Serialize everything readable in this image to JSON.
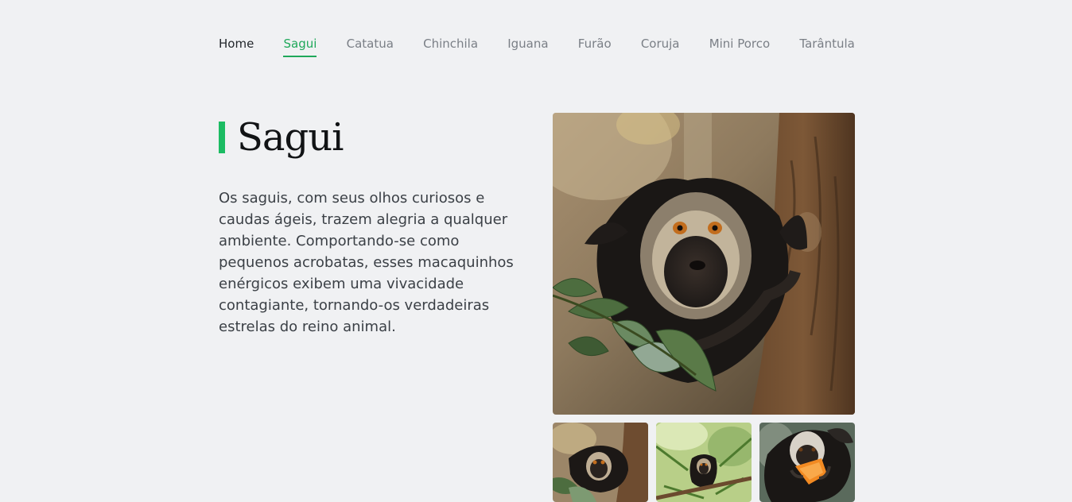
{
  "nav": {
    "items": [
      {
        "label": "Home"
      },
      {
        "label": "Sagui"
      },
      {
        "label": "Catatua"
      },
      {
        "label": "Chinchila"
      },
      {
        "label": "Iguana"
      },
      {
        "label": "Furão"
      },
      {
        "label": "Coruja"
      },
      {
        "label": "Mini Porco"
      },
      {
        "label": "Tarântula"
      }
    ],
    "active": "Sagui"
  },
  "animal": {
    "title": "Sagui",
    "description": "Os saguis, com seus olhos curiosos e caudas ágeis, trazem alegria a qualquer ambiente. Comportando-se como pequenos acrobatas, esses macaquinhos enérgicos exibem uma vivacidade contagiante, tornando-os verdadeiras estrelas do reino animal."
  },
  "colors": {
    "accent": "#1cbc63",
    "active_link": "#1fa85a",
    "background": "#f0f1f3",
    "text": "#3b4046"
  },
  "gallery": {
    "main_icon": "marmoset-photo",
    "thumbnails": [
      "marmoset-on-tree-photo",
      "marmoset-in-leaves-photo",
      "marmoset-eating-photo"
    ]
  }
}
